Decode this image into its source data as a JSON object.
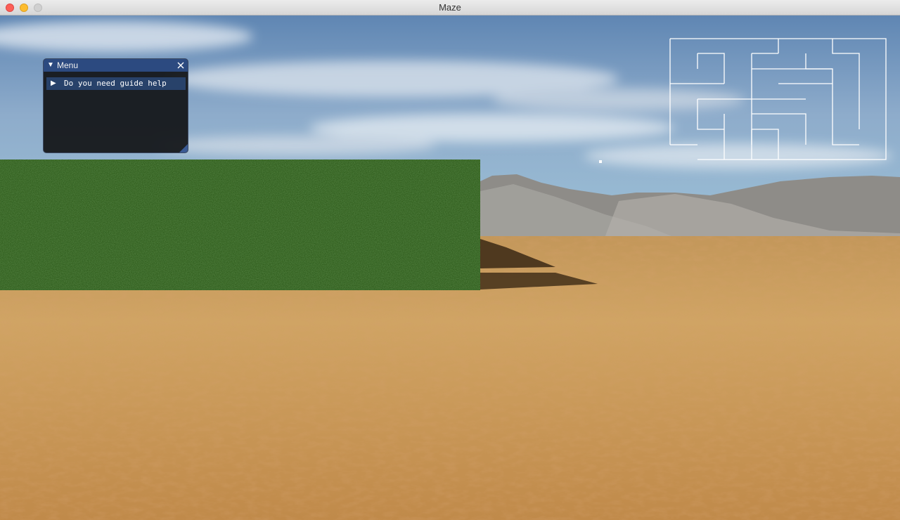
{
  "window": {
    "title": "Maze"
  },
  "menu": {
    "title": "Menu",
    "collapse_icon": "triangle-down-icon",
    "close_icon": "close-icon",
    "items": [
      {
        "label": "Do you need guide help",
        "icon": "triangle-right-icon",
        "expanded": false
      }
    ]
  },
  "minimap": {
    "label": "maze-minimap",
    "wall_color": "#ffffff"
  },
  "colors": {
    "menu_title_bg": "#2c4a80",
    "menu_item_bg": "#28426a",
    "menu_bg": "#14161a",
    "hedge": "#2f5c1c",
    "ground": "#c89a52",
    "sky": "#7fa3c7"
  }
}
